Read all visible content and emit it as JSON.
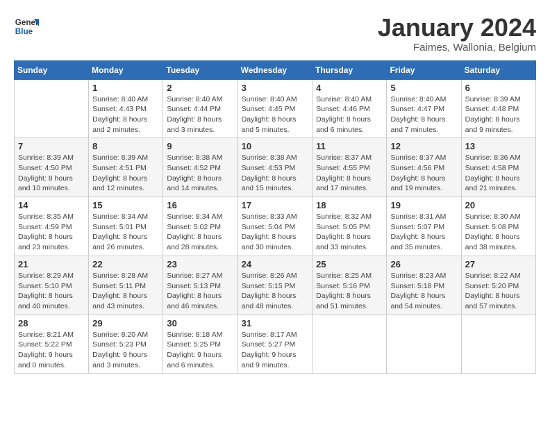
{
  "header": {
    "logo_general": "General",
    "logo_blue": "Blue",
    "month_title": "January 2024",
    "subtitle": "Faimes, Wallonia, Belgium"
  },
  "days_of_week": [
    "Sunday",
    "Monday",
    "Tuesday",
    "Wednesday",
    "Thursday",
    "Friday",
    "Saturday"
  ],
  "weeks": [
    [
      null,
      {
        "num": "1",
        "sunrise": "8:40 AM",
        "sunset": "4:43 PM",
        "daylight": "8 hours and 2 minutes."
      },
      {
        "num": "2",
        "sunrise": "8:40 AM",
        "sunset": "4:44 PM",
        "daylight": "8 hours and 3 minutes."
      },
      {
        "num": "3",
        "sunrise": "8:40 AM",
        "sunset": "4:45 PM",
        "daylight": "8 hours and 5 minutes."
      },
      {
        "num": "4",
        "sunrise": "8:40 AM",
        "sunset": "4:46 PM",
        "daylight": "8 hours and 6 minutes."
      },
      {
        "num": "5",
        "sunrise": "8:40 AM",
        "sunset": "4:47 PM",
        "daylight": "8 hours and 7 minutes."
      },
      {
        "num": "6",
        "sunrise": "8:39 AM",
        "sunset": "4:48 PM",
        "daylight": "8 hours and 9 minutes."
      }
    ],
    [
      {
        "num": "7",
        "sunrise": "8:39 AM",
        "sunset": "4:50 PM",
        "daylight": "8 hours and 10 minutes."
      },
      {
        "num": "8",
        "sunrise": "8:39 AM",
        "sunset": "4:51 PM",
        "daylight": "8 hours and 12 minutes."
      },
      {
        "num": "9",
        "sunrise": "8:38 AM",
        "sunset": "4:52 PM",
        "daylight": "8 hours and 14 minutes."
      },
      {
        "num": "10",
        "sunrise": "8:38 AM",
        "sunset": "4:53 PM",
        "daylight": "8 hours and 15 minutes."
      },
      {
        "num": "11",
        "sunrise": "8:37 AM",
        "sunset": "4:55 PM",
        "daylight": "8 hours and 17 minutes."
      },
      {
        "num": "12",
        "sunrise": "8:37 AM",
        "sunset": "4:56 PM",
        "daylight": "8 hours and 19 minutes."
      },
      {
        "num": "13",
        "sunrise": "8:36 AM",
        "sunset": "4:58 PM",
        "daylight": "8 hours and 21 minutes."
      }
    ],
    [
      {
        "num": "14",
        "sunrise": "8:35 AM",
        "sunset": "4:59 PM",
        "daylight": "8 hours and 23 minutes."
      },
      {
        "num": "15",
        "sunrise": "8:34 AM",
        "sunset": "5:01 PM",
        "daylight": "8 hours and 26 minutes."
      },
      {
        "num": "16",
        "sunrise": "8:34 AM",
        "sunset": "5:02 PM",
        "daylight": "8 hours and 28 minutes."
      },
      {
        "num": "17",
        "sunrise": "8:33 AM",
        "sunset": "5:04 PM",
        "daylight": "8 hours and 30 minutes."
      },
      {
        "num": "18",
        "sunrise": "8:32 AM",
        "sunset": "5:05 PM",
        "daylight": "8 hours and 33 minutes."
      },
      {
        "num": "19",
        "sunrise": "8:31 AM",
        "sunset": "5:07 PM",
        "daylight": "8 hours and 35 minutes."
      },
      {
        "num": "20",
        "sunrise": "8:30 AM",
        "sunset": "5:08 PM",
        "daylight": "8 hours and 38 minutes."
      }
    ],
    [
      {
        "num": "21",
        "sunrise": "8:29 AM",
        "sunset": "5:10 PM",
        "daylight": "8 hours and 40 minutes."
      },
      {
        "num": "22",
        "sunrise": "8:28 AM",
        "sunset": "5:11 PM",
        "daylight": "8 hours and 43 minutes."
      },
      {
        "num": "23",
        "sunrise": "8:27 AM",
        "sunset": "5:13 PM",
        "daylight": "8 hours and 46 minutes."
      },
      {
        "num": "24",
        "sunrise": "8:26 AM",
        "sunset": "5:15 PM",
        "daylight": "8 hours and 48 minutes."
      },
      {
        "num": "25",
        "sunrise": "8:25 AM",
        "sunset": "5:16 PM",
        "daylight": "8 hours and 51 minutes."
      },
      {
        "num": "26",
        "sunrise": "8:23 AM",
        "sunset": "5:18 PM",
        "daylight": "8 hours and 54 minutes."
      },
      {
        "num": "27",
        "sunrise": "8:22 AM",
        "sunset": "5:20 PM",
        "daylight": "8 hours and 57 minutes."
      }
    ],
    [
      {
        "num": "28",
        "sunrise": "8:21 AM",
        "sunset": "5:22 PM",
        "daylight": "9 hours and 0 minutes."
      },
      {
        "num": "29",
        "sunrise": "8:20 AM",
        "sunset": "5:23 PM",
        "daylight": "9 hours and 3 minutes."
      },
      {
        "num": "30",
        "sunrise": "8:18 AM",
        "sunset": "5:25 PM",
        "daylight": "9 hours and 6 minutes."
      },
      {
        "num": "31",
        "sunrise": "8:17 AM",
        "sunset": "5:27 PM",
        "daylight": "9 hours and 9 minutes."
      },
      null,
      null,
      null
    ]
  ],
  "labels": {
    "sunrise": "Sunrise:",
    "sunset": "Sunset:",
    "daylight": "Daylight:"
  }
}
